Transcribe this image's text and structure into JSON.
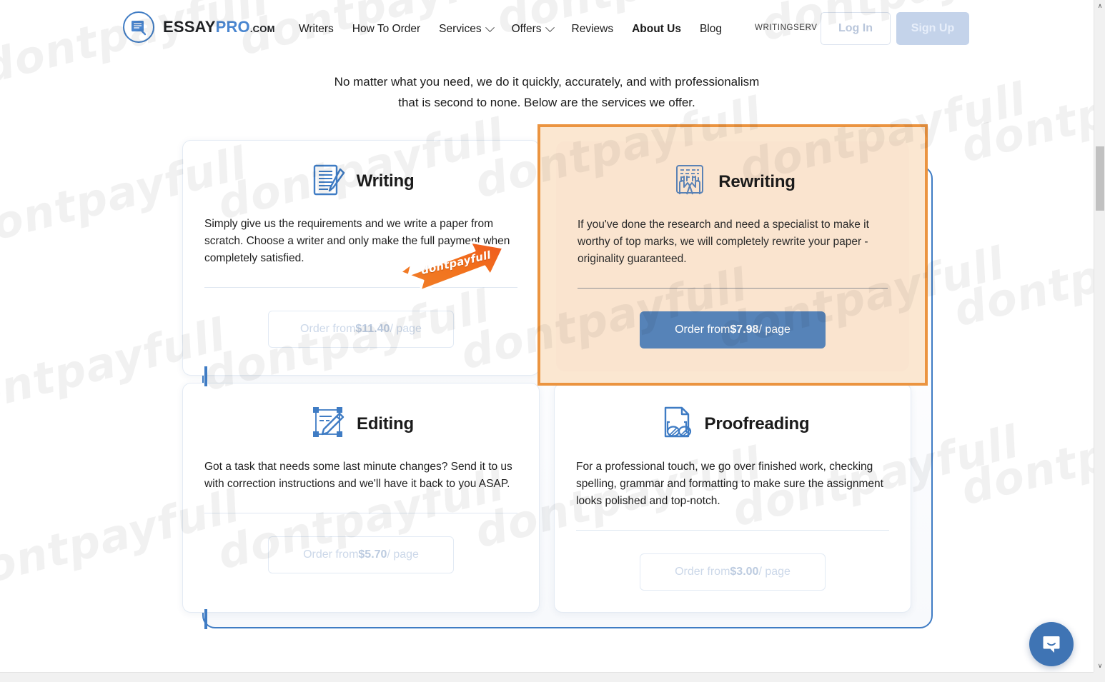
{
  "header": {
    "logo": {
      "part1": "ESSAY",
      "part2": "PRO",
      "part3": ".COM",
      "icon": "document-pen-logo-icon"
    },
    "nav": [
      {
        "label": "Writers",
        "has_caret": false,
        "active": false
      },
      {
        "label": "How To Order",
        "has_caret": false,
        "active": false
      },
      {
        "label": "Services",
        "has_caret": true,
        "active": false
      },
      {
        "label": "Offers",
        "has_caret": true,
        "active": false
      },
      {
        "label": "Reviews",
        "has_caret": false,
        "active": false
      },
      {
        "label": "About Us",
        "has_caret": false,
        "active": true
      },
      {
        "label": "Blog",
        "has_caret": false,
        "active": false
      }
    ],
    "brand_tag": "WRITINGSERV",
    "login_label": "Log In",
    "signup_label": "Sign Up"
  },
  "intro": {
    "line1": "No matter what you need, we do it quickly, accurately, and with professionalism",
    "line2": "that is second to none. Below are the services we offer."
  },
  "cards": {
    "writing": {
      "icon": "writing-paper-pen-icon",
      "title": "Writing",
      "description": "Simply give us the requirements and we write a paper from scratch. Choose a writer and only make the full payment when completely satisfied.",
      "cta_prefix": "Order from ",
      "cta_price": "$11.40",
      "cta_suffix": "/ page"
    },
    "rewriting": {
      "icon": "keyboard-hands-typing-icon",
      "title": "Rewriting",
      "description": "If you've done the research and need a specialist to make it worthy of top marks, we will completely rewrite your paper - originality guaranteed.",
      "cta_prefix": "Order from ",
      "cta_price": "$7.98",
      "cta_suffix": "/ page",
      "highlighted": true,
      "highlight_color": "#eb9440"
    },
    "editing": {
      "icon": "editing-pencil-crop-icon",
      "title": "Editing",
      "description": "Got a task that needs some last minute changes? Send it to us with correction instructions and we'll have it back to you ASAP.",
      "cta_prefix": "Order from ",
      "cta_price": "$5.70",
      "cta_suffix": "/ page"
    },
    "proofreading": {
      "icon": "document-glasses-icon",
      "title": "Proofreading",
      "description": "For a professional touch, we go over finished work, checking spelling, grammar and formatting to make sure the assignment looks polished and top-notch.",
      "cta_prefix": "Order from ",
      "cta_price": "$3.00",
      "cta_suffix": "/ page"
    }
  },
  "overlay": {
    "arrow_sticker_label": "dontpayfull",
    "arrow_sticker_color": "#f26a21",
    "watermark_text": "dontpayfull"
  },
  "chat": {
    "icon": "chat-smile-bubble-icon"
  },
  "scrollbar": {
    "up_arrow": "∧",
    "down_arrow": "∨"
  },
  "colors": {
    "brand_blue": "#3f7cc4",
    "cta_blue": "#5683b8",
    "highlight_orange": "#eb9440",
    "highlight_bg": "#fae4cf"
  }
}
